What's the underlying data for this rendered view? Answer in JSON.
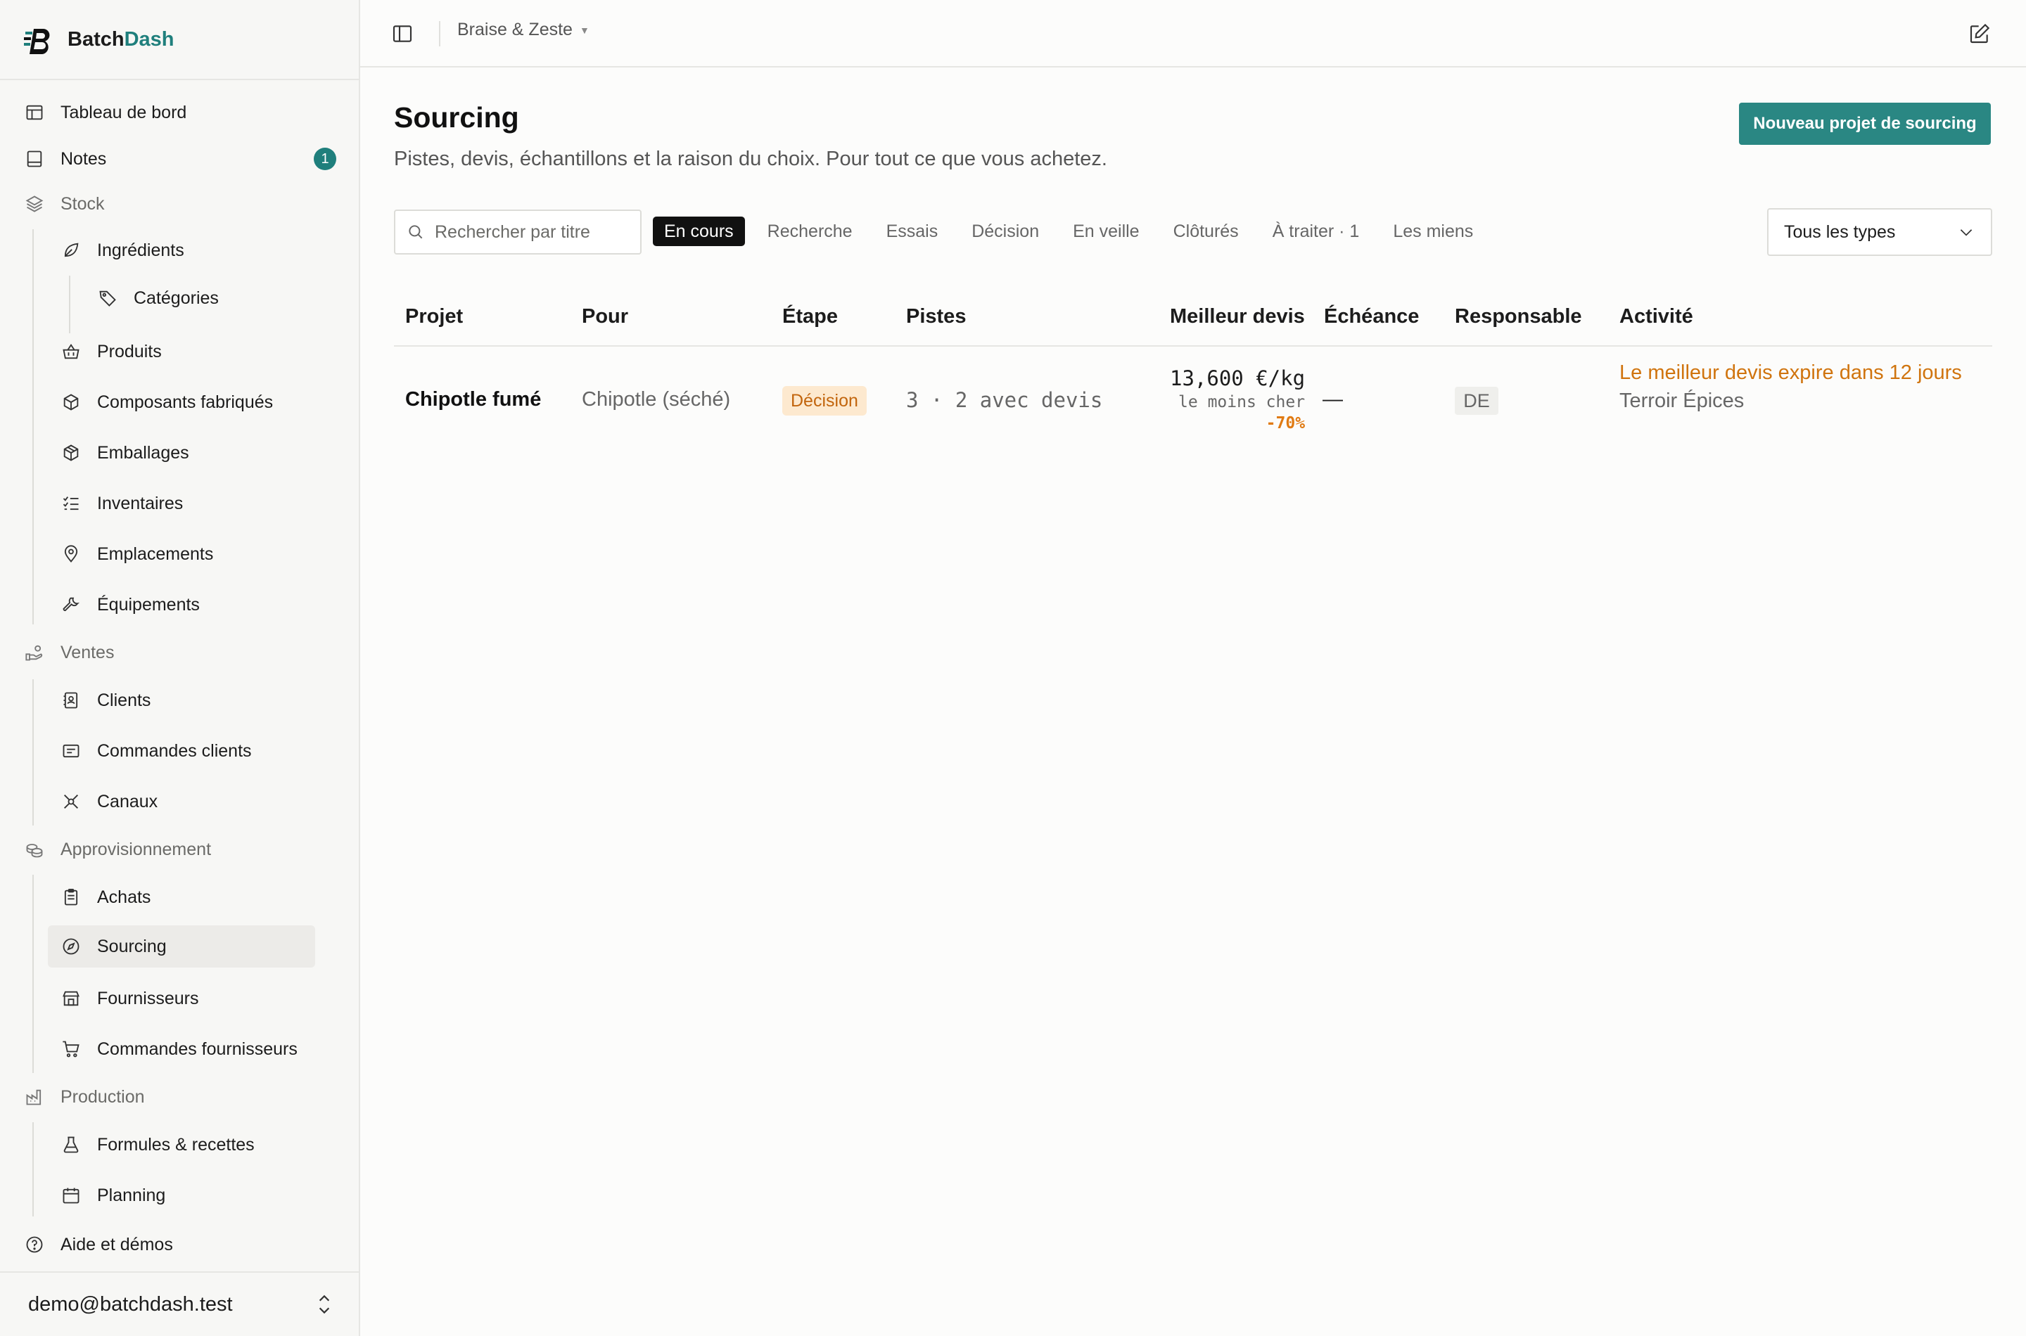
{
  "brand": {
    "name_part1": "Batch",
    "name_part2": "Dash"
  },
  "topbar": {
    "organization": "Braise & Zeste"
  },
  "sidebar": {
    "dashboard": "Tableau de bord",
    "notes": "Notes",
    "notes_badge": "1",
    "stock": "Stock",
    "ingredients": "Ingrédients",
    "categories": "Catégories",
    "produits": "Produits",
    "composants": "Composants fabriqués",
    "emballages": "Emballages",
    "inventaires": "Inventaires",
    "emplacements": "Emplacements",
    "equipements": "Équipements",
    "ventes": "Ventes",
    "clients": "Clients",
    "commandes_clients": "Commandes clients",
    "canaux": "Canaux",
    "approvisionnement": "Approvisionnement",
    "achats": "Achats",
    "sourcing": "Sourcing",
    "fournisseurs": "Fournisseurs",
    "commandes_fournisseurs": "Commandes fournisseurs",
    "production": "Production",
    "formules": "Formules & recettes",
    "planning": "Planning",
    "aide": "Aide et démos",
    "account_email": "demo@batchdash.test"
  },
  "page": {
    "title": "Sourcing",
    "subtitle": "Pistes, devis, échantillons et la raison du choix. Pour tout ce que vous achetez.",
    "new_button": "Nouveau projet de sourcing"
  },
  "filters": {
    "search_placeholder": "Rechercher par titre",
    "tabs": [
      "En cours",
      "Recherche",
      "Essais",
      "Décision",
      "En veille",
      "Clôturés",
      "À traiter · 1",
      "Les miens"
    ],
    "active_tab": "En cours",
    "type_select": "Tous les types"
  },
  "table": {
    "headers": [
      "Projet",
      "Pour",
      "Étape",
      "Pistes",
      "Meilleur devis",
      "Échéance",
      "Responsable",
      "Activité"
    ],
    "rows": [
      {
        "projet": "Chipotle fumé",
        "pour": "Chipotle (séché)",
        "etape": "Décision",
        "pistes": "3 · 2 avec devis",
        "meilleur_devis": "13,600 €/kg",
        "devis_note": "le moins cher",
        "devis_ecart": "-70%",
        "echeance": "—",
        "responsable": "DE",
        "activite": "Le meilleur devis expire dans 12 jours",
        "fournisseur": "Terroir Épices"
      }
    ]
  },
  "colors": {
    "accent": "#2a8783",
    "brand": "#1f7f7c",
    "warning": "#d0740e",
    "stage_bg": "#fde9cf"
  }
}
